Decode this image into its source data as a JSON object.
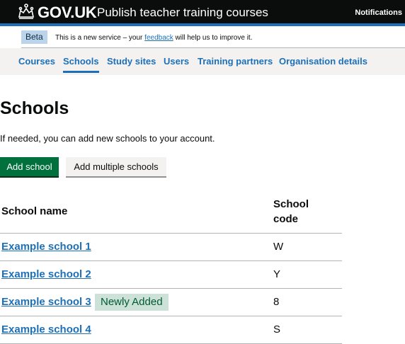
{
  "header": {
    "logo_text": "GOV.UK",
    "service_name": "Publish teacher training courses",
    "notifications_label": "Notifications",
    "crown_icon": "crown-icon"
  },
  "phase_banner": {
    "tag": "Beta",
    "text_before": "This is a new service – your ",
    "link_text": "feedback",
    "text_after": " will help us to improve it."
  },
  "nav": {
    "items": [
      {
        "label": "Courses"
      },
      {
        "label": "Schools",
        "active": true
      },
      {
        "label": "Study sites"
      },
      {
        "label": "Users"
      },
      {
        "label": "Training partners"
      },
      {
        "label": "Organisation details"
      }
    ]
  },
  "main": {
    "title": "Schools",
    "intro": "If needed, you can add new schools to your account.",
    "add_school_label": "Add school",
    "add_multiple_label": "Add multiple schools"
  },
  "table": {
    "headers": {
      "name": "School name",
      "code_line1": "School",
      "code_line2": "code"
    },
    "rows": [
      {
        "name": "Example school 1",
        "code": "W"
      },
      {
        "name": "Example school 2",
        "code": "Y"
      },
      {
        "name": "Example school 3",
        "code": "8",
        "tag": "Newly Added"
      },
      {
        "name": "Example school 4",
        "code": "S"
      }
    ]
  },
  "colors": {
    "header_bg": "#0b0c0c",
    "link": "#1d70b8",
    "primary_button": "#00703c",
    "tag_bg": "#cce2d8",
    "tag_text": "#005a30"
  }
}
